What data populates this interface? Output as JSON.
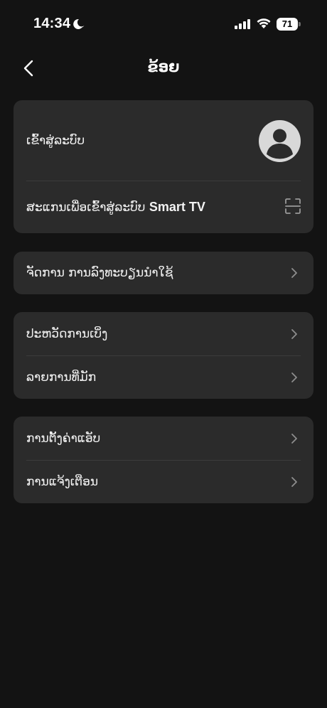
{
  "status_bar": {
    "time": "14:34",
    "battery": "71",
    "icons": [
      "moon-icon",
      "signal-icon",
      "wifi-icon",
      "battery-icon"
    ]
  },
  "header": {
    "title": "ຂ້ອຍ",
    "back_icon": "chevron-left-icon"
  },
  "account_card": {
    "login_label": "ເຂົ້າສູ່ລະບົບ",
    "scan_label_lao": "ສະແກນເພື່ອເຂົ້າສູ່ລະບົບ ",
    "scan_label_latin": "Smart TV",
    "avatar_icon": "user-avatar-icon",
    "scan_icon": "qr-scan-icon"
  },
  "devices_card": {
    "items": [
      {
        "label": "ຈັດການ ການລົງທະບຽນນຳໃຊ້"
      }
    ]
  },
  "history_card": {
    "items": [
      {
        "label": "ປະຫວັດການເບິ່ງ"
      },
      {
        "label": "ລາຍການທີ່ມັກ"
      }
    ]
  },
  "settings_card": {
    "items": [
      {
        "label": "ການຕັ້ງຄ່າແອັບ"
      },
      {
        "label": "ການແຈ້ງເຕືອນ"
      }
    ]
  },
  "colors": {
    "background": "#131313",
    "card": "#2b2b2b",
    "divider": "#3c3c3c",
    "text": "#f2f2f2",
    "chevron": "#8e8e8e"
  }
}
